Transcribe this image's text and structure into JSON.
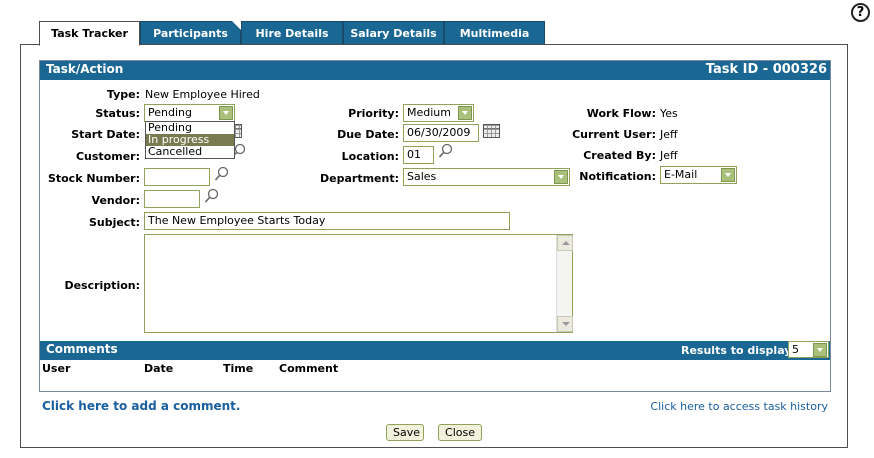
{
  "help": {
    "glyph": "?"
  },
  "tabs": [
    {
      "label": "Task Tracker",
      "active": true
    },
    {
      "label": "Participants"
    },
    {
      "label": "Hire Details"
    },
    {
      "label": "Salary Details"
    },
    {
      "label": "Multimedia"
    }
  ],
  "task": {
    "section_title": "Task/Action",
    "task_id": "Task ID - 000326",
    "type_label": "Type:",
    "type_value": "New Employee Hired",
    "status_label": "Status:",
    "status_value": "Pending",
    "status_options": [
      "Pending",
      "In progress",
      "Cancelled"
    ],
    "start_date_label": "Start Date:",
    "customer_label": "Customer:",
    "stock_number_label": "Stock Number:",
    "vendor_label": "Vendor:",
    "subject_label": "Subject:",
    "subject_value": "The New Employee Starts Today",
    "description_label": "Description:",
    "priority_label": "Priority:",
    "priority_value": "Medium",
    "due_date_label": "Due Date:",
    "due_date_value": "06/30/2009",
    "location_label": "Location:",
    "location_value": "01",
    "department_label": "Department:",
    "department_value": "Sales",
    "workflow_label": "Work Flow:",
    "workflow_value": "Yes",
    "current_user_label": "Current User:",
    "current_user_value": "Jeff",
    "created_by_label": "Created By:",
    "created_by_value": "Jeff",
    "notification_label": "Notification:",
    "notification_value": "E-Mail"
  },
  "comments": {
    "section_title": "Comments",
    "results_label": "Results to display:",
    "results_value": "5",
    "columns": [
      "User",
      "Date",
      "Time",
      "Comment"
    ]
  },
  "links": {
    "add_comment": "Click here to add a comment.",
    "task_history": "Click here to access task history"
  },
  "buttons": {
    "save": "Save",
    "close": "Close"
  },
  "colors": {
    "header_blue": "#1a6794",
    "field_border": "#8ea25a",
    "link_blue": "#1a5fa0"
  }
}
